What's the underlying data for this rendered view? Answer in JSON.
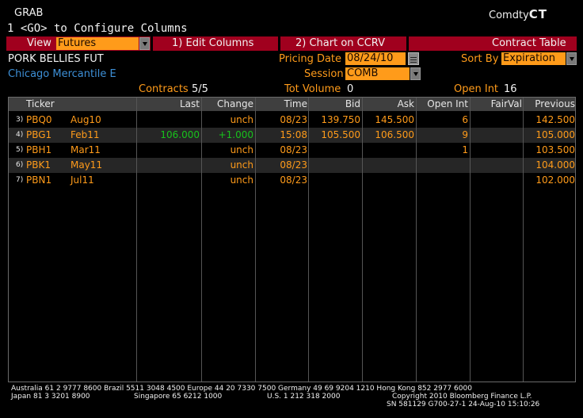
{
  "header": {
    "function": "GRAB",
    "command": "1 <GO> to Configure Columns",
    "ticker_prefix": "Comdty",
    "ticker_code": "CT"
  },
  "menu": {
    "view_label": "View",
    "view_value": "Futures",
    "edit_columns": "1)  Edit Columns",
    "chart": "2)  Chart on CCRV",
    "contract_table": "Contract Table"
  },
  "info": {
    "name": "PORK BELLIES FUT",
    "exchange": "Chicago Mercantile E",
    "pricing_date_label": "Pricing Date",
    "pricing_date": "08/24/10",
    "sort_by_label": "Sort By",
    "sort_by_value": "Expiration",
    "session_label": "Session",
    "session_value": "COMB",
    "contracts_label": "Contracts",
    "contracts_value": "5/5",
    "tot_volume_label": "Tot Volume",
    "tot_volume_value": "0",
    "open_int_label": "Open Int",
    "open_int_value": "16"
  },
  "table": {
    "columns": [
      "Ticker",
      "Last",
      "Change",
      "Time",
      "Bid",
      "Ask",
      "Open Int",
      "FairVal",
      "Previous"
    ],
    "rows": [
      {
        "num": "3)",
        "ticker": "PBQ0",
        "month": "Aug10",
        "last": "",
        "change": "unch",
        "time": "08/23",
        "bid": "139.750",
        "ask": "145.500",
        "open_int": "6",
        "fairval": "",
        "previous": "142.500"
      },
      {
        "num": "4)",
        "ticker": "PBG1",
        "month": "Feb11",
        "last": "106.000",
        "change": "+1.000",
        "time": "15:08",
        "bid": "105.500",
        "ask": "106.500",
        "open_int": "9",
        "fairval": "",
        "previous": "105.000"
      },
      {
        "num": "5)",
        "ticker": "PBH1",
        "month": "Mar11",
        "last": "",
        "change": "unch",
        "time": "08/23",
        "bid": "",
        "ask": "",
        "open_int": "1",
        "fairval": "",
        "previous": "103.500"
      },
      {
        "num": "6)",
        "ticker": "PBK1",
        "month": "May11",
        "last": "",
        "change": "unch",
        "time": "08/23",
        "bid": "",
        "ask": "",
        "open_int": "",
        "fairval": "",
        "previous": "104.000"
      },
      {
        "num": "7)",
        "ticker": "PBN1",
        "month": "Jul11",
        "last": "",
        "change": "unch",
        "time": "08/23",
        "bid": "",
        "ask": "",
        "open_int": "",
        "fairval": "",
        "previous": "102.000"
      }
    ]
  },
  "footer": {
    "line1": "Australia 61 2 9777 8600 Brazil 5511 3048 4500 Europe 44 20 7330 7500 Germany 49 69 9204 1210 Hong Kong 852 2977 6000",
    "line2_left": "Japan 81 3 3201 8900",
    "line2_mid1": "Singapore 65 6212 1000",
    "line2_mid2": "U.S. 1 212 318 2000",
    "line2_right": "Copyright 2010 Bloomberg Finance L.P.",
    "line3": "SN 581129 G700-27-1 24-Aug-10 15:10:26"
  },
  "colors": {
    "menu_bar": "#a0001e",
    "accent_orange": "#ff9b1a",
    "link_blue": "#3d8fd6",
    "positive_green": "#18c21c"
  }
}
